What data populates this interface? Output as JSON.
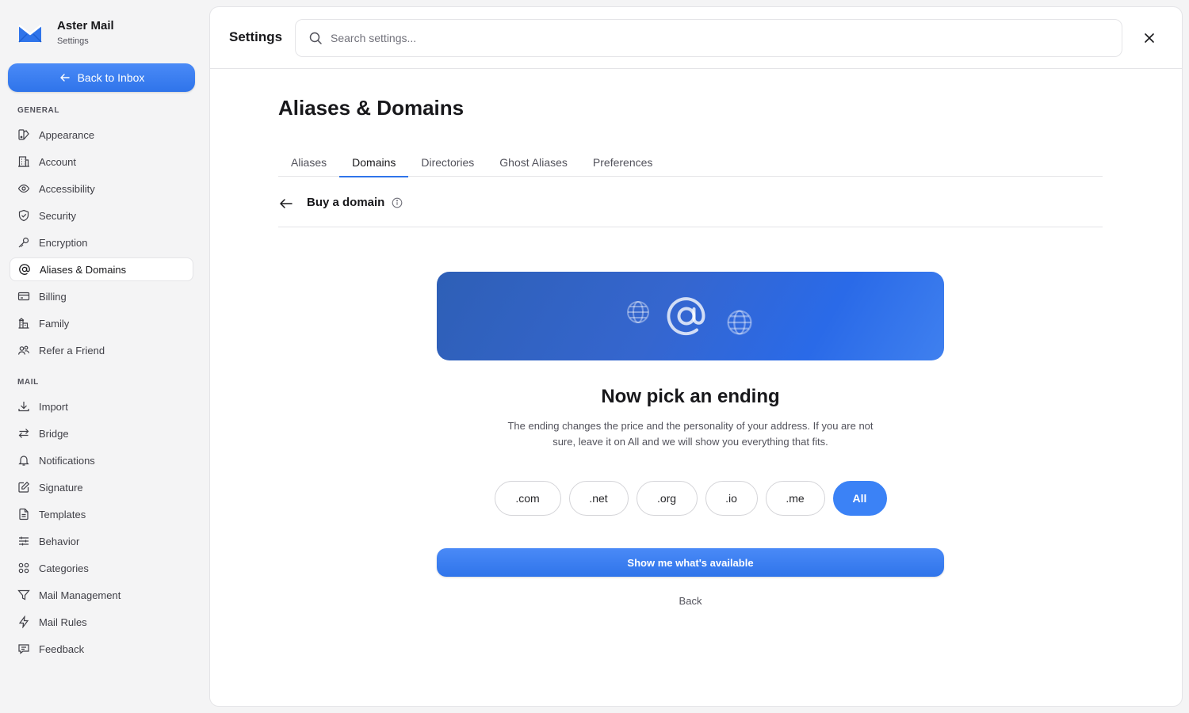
{
  "brand": {
    "name": "Aster Mail",
    "subtitle": "Settings"
  },
  "sidebar": {
    "back_label": "Back to Inbox",
    "general_label": "GENERAL",
    "general_items": [
      {
        "label": "Appearance",
        "icon": "palette-icon"
      },
      {
        "label": "Account",
        "icon": "building-icon"
      },
      {
        "label": "Accessibility",
        "icon": "eye-icon"
      },
      {
        "label": "Security",
        "icon": "shield-check-icon"
      },
      {
        "label": "Encryption",
        "icon": "key-icon"
      },
      {
        "label": "Aliases & Domains",
        "icon": "at-sign-icon",
        "active": true
      },
      {
        "label": "Billing",
        "icon": "credit-card-icon"
      },
      {
        "label": "Family",
        "icon": "family-icon"
      },
      {
        "label": "Refer a Friend",
        "icon": "users-icon"
      }
    ],
    "mail_label": "MAIL",
    "mail_items": [
      {
        "label": "Import",
        "icon": "download-icon"
      },
      {
        "label": "Bridge",
        "icon": "arrows-swap-icon"
      },
      {
        "label": "Notifications",
        "icon": "bell-icon"
      },
      {
        "label": "Signature",
        "icon": "pen-square-icon"
      },
      {
        "label": "Templates",
        "icon": "file-text-icon"
      },
      {
        "label": "Behavior",
        "icon": "sliders-icon"
      },
      {
        "label": "Categories",
        "icon": "grid-icon"
      },
      {
        "label": "Mail Management",
        "icon": "filter-icon"
      },
      {
        "label": "Mail Rules",
        "icon": "zap-icon"
      },
      {
        "label": "Feedback",
        "icon": "message-icon"
      }
    ]
  },
  "header": {
    "title": "Settings",
    "search_placeholder": "Search settings..."
  },
  "main": {
    "page_title": "Aliases & Domains",
    "tabs": [
      {
        "label": "Aliases"
      },
      {
        "label": "Domains",
        "active": true
      },
      {
        "label": "Directories"
      },
      {
        "label": "Ghost Aliases"
      },
      {
        "label": "Preferences"
      }
    ],
    "subheader_title": "Buy a domain",
    "step_title": "Now pick an ending",
    "step_description": "The ending changes the price and the personality of your address. If you are not sure, leave it on All and we will show you everything that fits.",
    "endings": [
      {
        "label": ".com"
      },
      {
        "label": ".net"
      },
      {
        "label": ".org"
      },
      {
        "label": ".io"
      },
      {
        "label": ".me"
      },
      {
        "label": "All",
        "selected": true
      }
    ],
    "primary_button": "Show me what's available",
    "back_link": "Back"
  },
  "colors": {
    "accent": "#3b82f6",
    "hero_start": "#2e5fb6",
    "hero_end": "#3f80ef"
  }
}
